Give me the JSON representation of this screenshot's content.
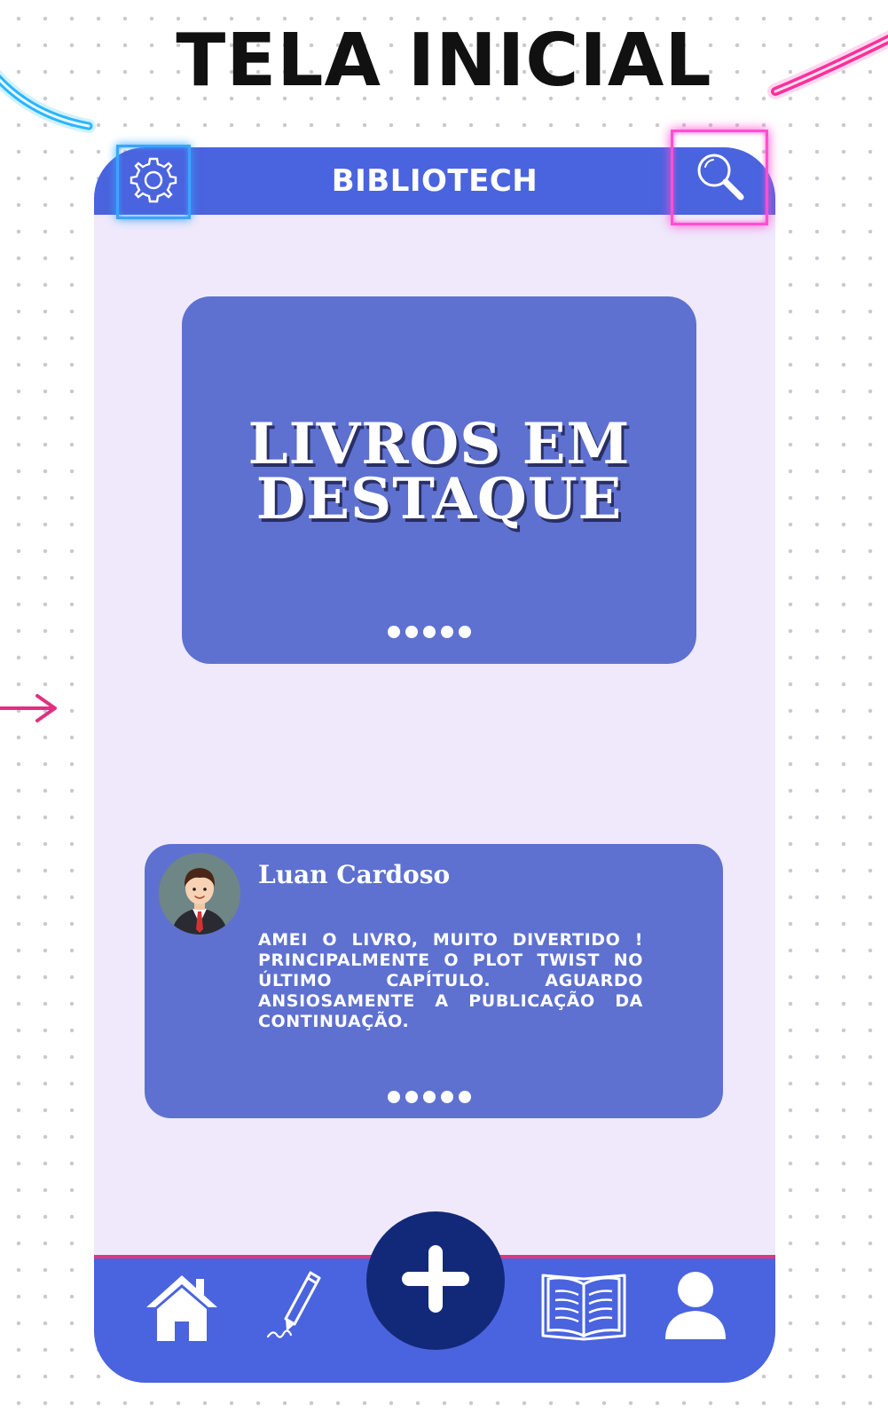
{
  "page": {
    "title": "TELA INICIAL"
  },
  "app": {
    "title": "BIBLIOTECH"
  },
  "header": {
    "settings_icon": "gear-icon",
    "search_icon": "search-icon",
    "settings_highlight_color": "#3aa4ff",
    "search_highlight_color": "#ff4fd2"
  },
  "featured": {
    "line1": "LIVROS EM",
    "line2": "DESTAQUE",
    "pagination_dots": 5
  },
  "review": {
    "user_name": "Luan Cardoso",
    "text": "AMEI O LIVRO, MUITO DIVERTIDO ! PRINCIPALMENTE O PLOT TWIST NO ÚLTIMO CAPÍTULO. AGUARDO ANSIOSAMENTE A PUBLICAÇÃO DA CONTINUAÇÃO.",
    "avatar_icon": "user-avatar",
    "pagination_dots": 5
  },
  "bottom_nav": {
    "items": [
      {
        "icon": "home-icon"
      },
      {
        "icon": "pen-icon"
      },
      {
        "icon": "plus-icon"
      },
      {
        "icon": "book-icon"
      },
      {
        "icon": "user-icon"
      }
    ]
  },
  "colors": {
    "primary": "#4a63de",
    "card": "#5e71d0",
    "screen_background": "#efe9fb",
    "fab": "#12297a",
    "divider": "#e2357f"
  }
}
